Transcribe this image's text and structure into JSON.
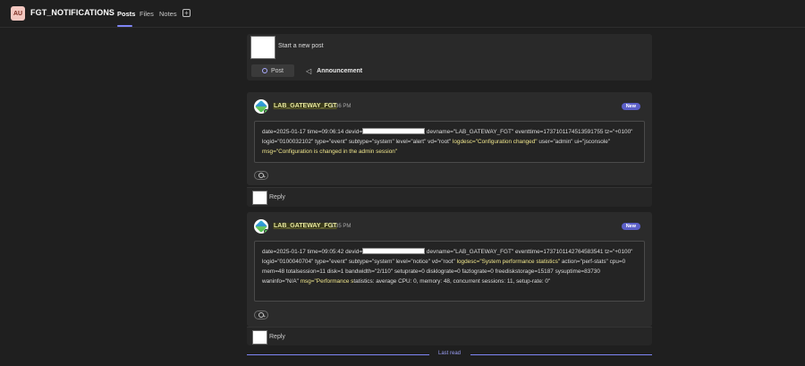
{
  "header": {
    "team_initials": "AU",
    "channel_name": "FGT_NOTIFICATIONS",
    "tabs": [
      {
        "label": "Posts"
      },
      {
        "label": "Files"
      },
      {
        "label": "Notes"
      }
    ],
    "add_tab": "+"
  },
  "compose": {
    "prompt": "Start a new post",
    "post_label": "Post",
    "announcement_label": "Announcement"
  },
  "messages": [
    {
      "sender": "LAB_GATEWAY_FGT",
      "time": "1:36 PM",
      "badge": "New",
      "body": {
        "part1": "date=2025-01-17 time=09:06:14 devid=",
        "part2": " devname=\"LAB_GATEWAY_FGT\" eventtime=1737101174513591755 tz=\"+0100\" logid=\"0100032102\" type=\"event\" subtype=\"system\" level=\"alert\" vd=\"root\" ",
        "hl1": "logdesc=\"Configuration changed\"",
        "part3": " user=\"admin\" ui=\"jsconsole\" ",
        "hl2": "msg=\"Configuration is changed in the admin session\""
      }
    },
    {
      "sender": "LAB_GATEWAY_FGT",
      "time": "1:35 PM",
      "badge": "New",
      "body": {
        "part1": "date=2025-01-17 time=09:05:42 devid=",
        "part2": " devname=\"LAB_GATEWAY_FGT\" eventtime=1737101142764583541 tz=\"+0100\" logid=\"0100040704\" type=\"event\" subtype=\"system\" level=\"notice\" vd=\"root\" ",
        "hl1": "logdesc=\"System performance statistics\"",
        "part3": " action=\"perf-stats\" cpu=0 mem=48 totalsession=11 disk=1 bandwidth=\"2/110\" setuprate=0 disklograte=0 fazlograte=0 freediskstorage=15187 sysuptime=83730 waninfo=\"N/A\" ",
        "hl2": "msg=\"Performance s",
        "part4": "tatistics: average CPU: 0, memory: 48, concurrent sessions: 11, setup-rate: 0\""
      }
    }
  ],
  "reply_label": "Reply",
  "last_read_label": "Last read",
  "colors": {
    "accent": "#7f85f5",
    "badge": "#5b5fc7",
    "highlight_text": "#f0e68c"
  },
  "icons": {
    "post": "circle-icon",
    "announcement": "megaphone-icon",
    "react": "emoji-add-icon"
  }
}
